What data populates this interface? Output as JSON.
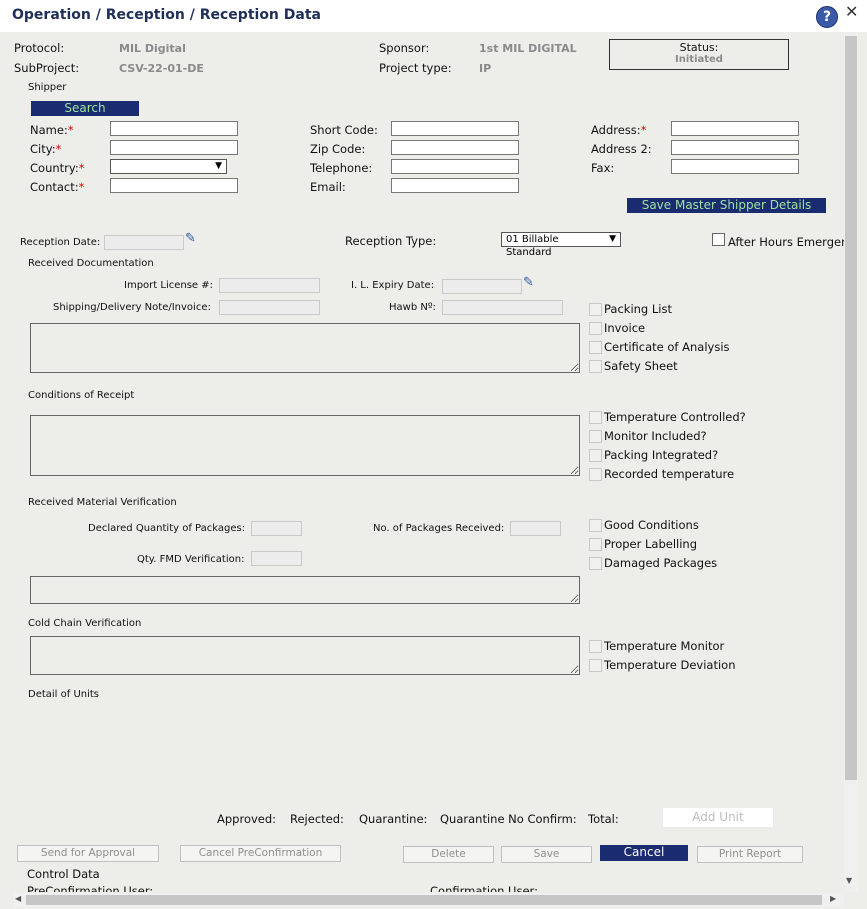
{
  "window": {
    "title": "Operation / Reception / Reception Data",
    "help_icon": "?",
    "close_icon": "✕"
  },
  "header": {
    "protocol_label": "Protocol:",
    "protocol_value": "MIL Digital",
    "subproject_label": "SubProject:",
    "subproject_value": "CSV-22-01-DE",
    "sponsor_label": "Sponsor:",
    "sponsor_value": "1st MIL DIGITAL",
    "project_type_label": "Project type:",
    "project_type_value": "IP",
    "status_label": "Status:",
    "status_value": "Initiated"
  },
  "shipper": {
    "section_label": "Shipper",
    "search_button": "Search",
    "name_label": "Name:",
    "city_label": "City:",
    "country_label": "Country:",
    "contact_label": "Contact:",
    "short_code_label": "Short Code:",
    "zip_label": "Zip Code:",
    "telephone_label": "Telephone:",
    "email_label": "Email:",
    "address_label": "Address:",
    "address2_label": "Address 2:",
    "fax_label": "Fax:",
    "required_mark": "*",
    "save_master_button": "Save Master Shipper Details"
  },
  "reception": {
    "date_label": "Reception Date:",
    "type_label": "Reception Type:",
    "type_value": "01 Billable Standard",
    "after_hours_label": "After Hours Emergen"
  },
  "documentation": {
    "section_label": "Received Documentation",
    "import_license_label": "Import License #:",
    "il_expiry_label": "I. L. Expiry Date:",
    "shipping_note_label": "Shipping/Delivery Note/Invoice:",
    "hawb_label": "Hawb Nº:",
    "checks": [
      "Packing List",
      "Invoice",
      "Certificate of Analysis",
      "Safety Sheet"
    ]
  },
  "conditions": {
    "section_label": "Conditions of Receipt",
    "checks": [
      "Temperature Controlled?",
      "Monitor Included?",
      "Packing Integrated?",
      "Recorded temperature"
    ]
  },
  "verification": {
    "section_label": "Received Material Verification",
    "declared_qty_label": "Declared Quantity of Packages:",
    "packages_received_label": "No. of Packages Received:",
    "qty_fmd_label": "Qty. FMD Verification:",
    "checks": [
      "Good Conditions",
      "Proper Labelling",
      "Damaged Packages"
    ]
  },
  "cold_chain": {
    "section_label": "Cold Chain Verification",
    "checks": [
      "Temperature Monitor",
      "Temperature Deviation"
    ]
  },
  "units": {
    "section_label": "Detail of Units",
    "approved_label": "Approved:",
    "rejected_label": "Rejected:",
    "quarantine_label": "Quarantine:",
    "quarantine_no_confirm_label": "Quarantine No Confirm:",
    "total_label": "Total:",
    "add_unit_button": "Add Unit"
  },
  "actions": {
    "send_for_approval": "Send for Approval",
    "cancel_preconfirmation": "Cancel PreConfirmation",
    "delete": "Delete",
    "save": "Save",
    "cancel": "Cancel",
    "print_report": "Print Report"
  },
  "control": {
    "section_label": "Control Data",
    "preconfirmation_user_label": "PreConfirmation User:",
    "confirmation_user_label": "Confirmation User:"
  },
  "colors": {
    "navy_button": "#1a2b70",
    "navy_button_text": "#9fe39f",
    "title_text": "#1f2f57",
    "required": "#d00000"
  }
}
